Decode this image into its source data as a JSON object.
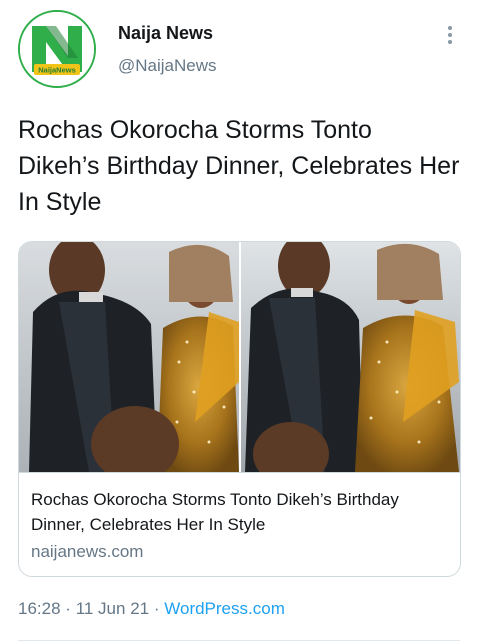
{
  "account": {
    "display_name": "Naija News",
    "handle": "@NaijaNews",
    "avatar_logo_text": "NaijaNews"
  },
  "tweet": {
    "text": "Rochas Okorocha Storms Tonto Dikeh’s Birthday Dinner, Celebrates Her In Style"
  },
  "card": {
    "title": "Rochas Okorocha Storms Tonto Dikeh’s Birthday Dinner, Celebrates Her In Style",
    "domain": "naijanews.com",
    "image_description_icon": "photo"
  },
  "meta": {
    "time": "16:28",
    "separator": "·",
    "date": "11 Jun 21",
    "source": "WordPress.com"
  },
  "icons": {
    "more": "more-vertical-icon"
  },
  "colors": {
    "brand_green": "#2fae4a",
    "link_blue": "#1da1f2",
    "secondary_text": "#657786"
  }
}
